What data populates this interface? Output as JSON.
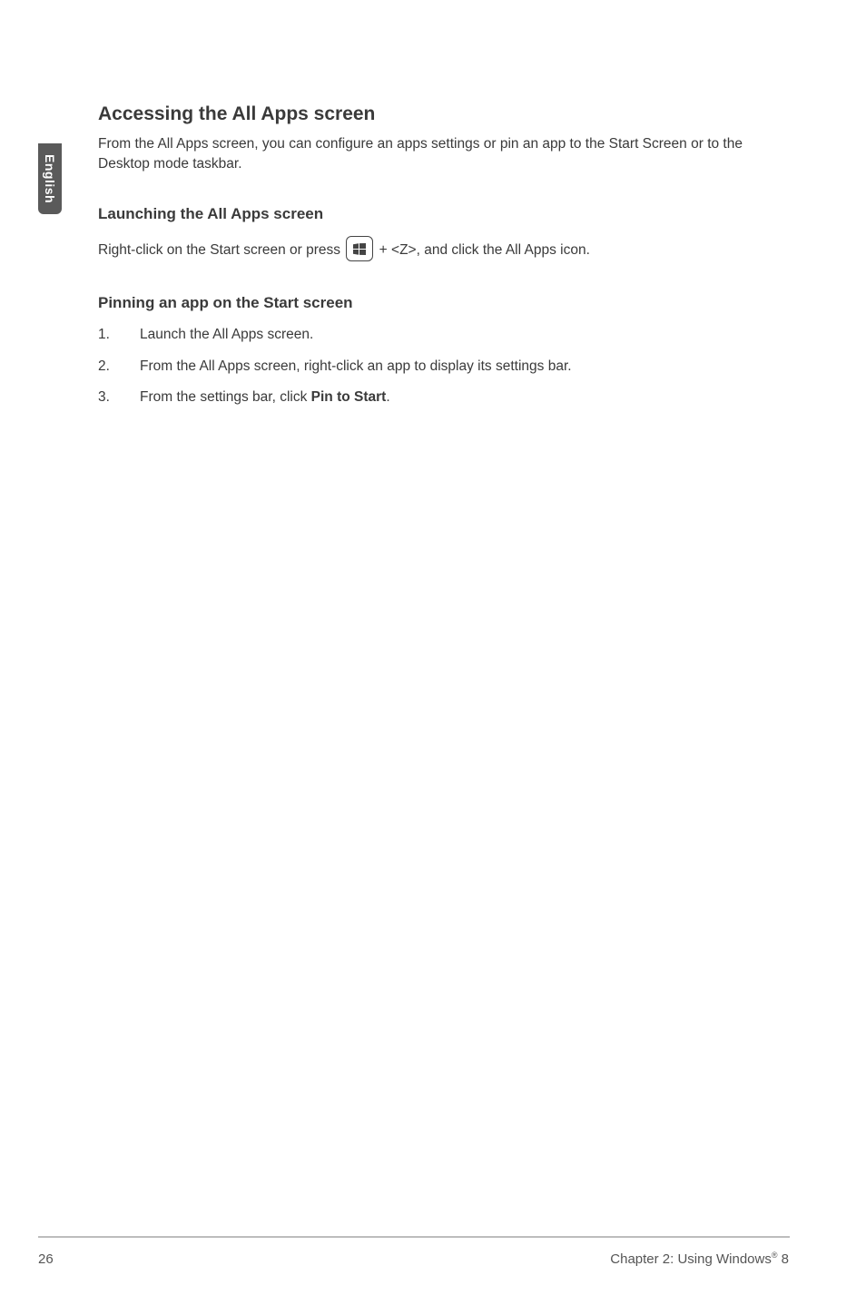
{
  "side_tab": "English",
  "main": {
    "heading": "Accessing the All Apps screen",
    "intro": "From the All Apps screen, you can configure an apps settings or pin an app to the Start Screen or to the Desktop mode taskbar.",
    "launch": {
      "heading": "Launching the All Apps screen",
      "text_before": "Right-click on the Start screen or press ",
      "text_after": " + <Z>, and click the All Apps icon."
    },
    "pinning": {
      "heading": "Pinning an app on the Start screen",
      "steps": [
        {
          "num": "1.",
          "text": "Launch the All Apps screen."
        },
        {
          "num": "2.",
          "text": "From the All Apps screen, right-click an app to display its settings bar."
        },
        {
          "num": "3.",
          "text_before": "From the settings bar, click ",
          "bold": "Pin to Start",
          "text_after": "."
        }
      ]
    }
  },
  "footer": {
    "page": "26",
    "chapter_before": "Chapter 2: Using Windows",
    "chapter_sup": "®",
    "chapter_after": " 8"
  }
}
